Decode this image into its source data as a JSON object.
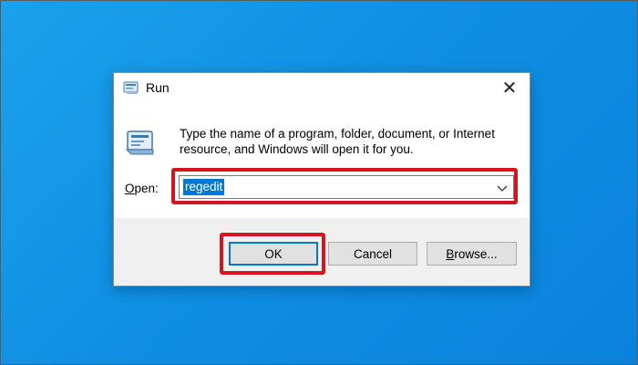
{
  "window": {
    "title": "Run",
    "close_glyph": "✕",
    "icon": "run-icon"
  },
  "content": {
    "description": "Type the name of a program, folder, document, or Internet resource, and Windows will open it for you.",
    "icon": "run-icon"
  },
  "open_field": {
    "label_prefix": "",
    "label_underlined": "O",
    "label_rest": "pen:",
    "value": "regedit",
    "selected": true,
    "dropdown_icon": "chevron-down-icon"
  },
  "buttons": {
    "ok": "OK",
    "cancel": "Cancel",
    "browse_underlined": "B",
    "browse_rest": "rowse..."
  },
  "colors": {
    "desktop": "#0f8fe3",
    "highlight_annotation": "#d4141f",
    "selection": "#0078d7",
    "focus_border": "#0078d7"
  }
}
